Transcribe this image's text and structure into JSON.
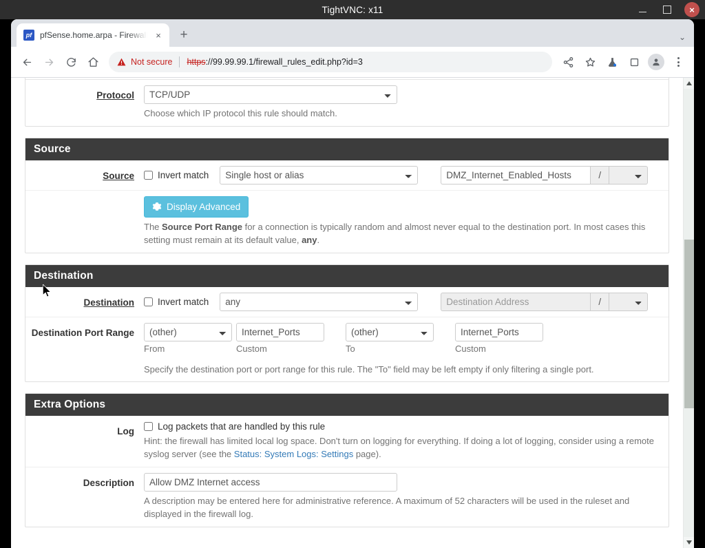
{
  "vnc": {
    "title": "TightVNC: x11",
    "minimize_label": "Minimize",
    "maximize_label": "Maximize",
    "close_label": "×"
  },
  "browser": {
    "tab": {
      "favicon_text": "pf",
      "title": "pfSense.home.arpa - Firewall: Rules",
      "close_label": "×"
    },
    "new_tab_label": "+",
    "tabstrip_expand_label": "⌄",
    "omnibox": {
      "security_label": "Not secure",
      "scheme": "https",
      "url_rest": "://99.99.99.1/firewall_rules_edit.php?id=3"
    },
    "icons": {
      "back": "back-arrow-icon",
      "forward": "forward-arrow-icon",
      "reload": "reload-icon",
      "home": "home-icon",
      "share": "share-icon",
      "bookmark": "star-icon",
      "experiments": "flask-icon",
      "side_panel": "side-panel-icon",
      "profile": "profile-avatar-icon",
      "menu": "three-dot-menu-icon"
    }
  },
  "form": {
    "protocol": {
      "label": "Protocol",
      "value": "TCP/UDP",
      "help": "Choose which IP protocol this rule should match."
    },
    "source_section": {
      "heading": "Source",
      "label": "Source",
      "invert_label": "Invert match",
      "type_value": "Single host or alias",
      "address_value": "DMZ_Internet_Enabled_Hosts",
      "slash": "/",
      "cidr_value": "",
      "advanced_button": "Display Advanced",
      "help_1": "The ",
      "help_bold_1": "Source Port Range",
      "help_2": " for a connection is typically random and almost never equal to the destination port. In most cases this setting must remain at its default value, ",
      "help_bold_2": "any",
      "help_3": "."
    },
    "destination_section": {
      "heading": "Destination",
      "label": "Destination",
      "invert_label": "Invert match",
      "type_value": "any",
      "address_placeholder": "Destination Address",
      "slash": "/",
      "cidr_value": "",
      "port_range_label": "Destination Port Range",
      "from_select": "(other)",
      "from_custom": "Internet_Ports",
      "to_select": "(other)",
      "to_custom": "Internet_Ports",
      "from_sublabel": "From",
      "from_custom_sublabel": "Custom",
      "to_sublabel": "To",
      "to_custom_sublabel": "Custom",
      "help": "Specify the destination port or port range for this rule. The \"To\" field may be left empty if only filtering a single port."
    },
    "extra_options_section": {
      "heading": "Extra Options",
      "log_label": "Log",
      "log_checkbox_label": "Log packets that are handled by this rule",
      "log_help_1": "Hint: the firewall has limited local log space. Don't turn on logging for everything. If doing a lot of logging, consider using a remote syslog server (see the ",
      "log_help_link": "Status: System Logs: Settings",
      "log_help_2": " page).",
      "description_label": "Description",
      "description_value": "Allow DMZ Internet access",
      "description_help": "A description may be entered here for administrative reference. A maximum of 52 characters will be used in the ruleset and displayed in the firewall log."
    }
  },
  "colors": {
    "section_heading_bg": "#3c3c3c",
    "info_button": "#5bc0de",
    "link": "#337ab7",
    "not_secure": "#c5221f"
  }
}
